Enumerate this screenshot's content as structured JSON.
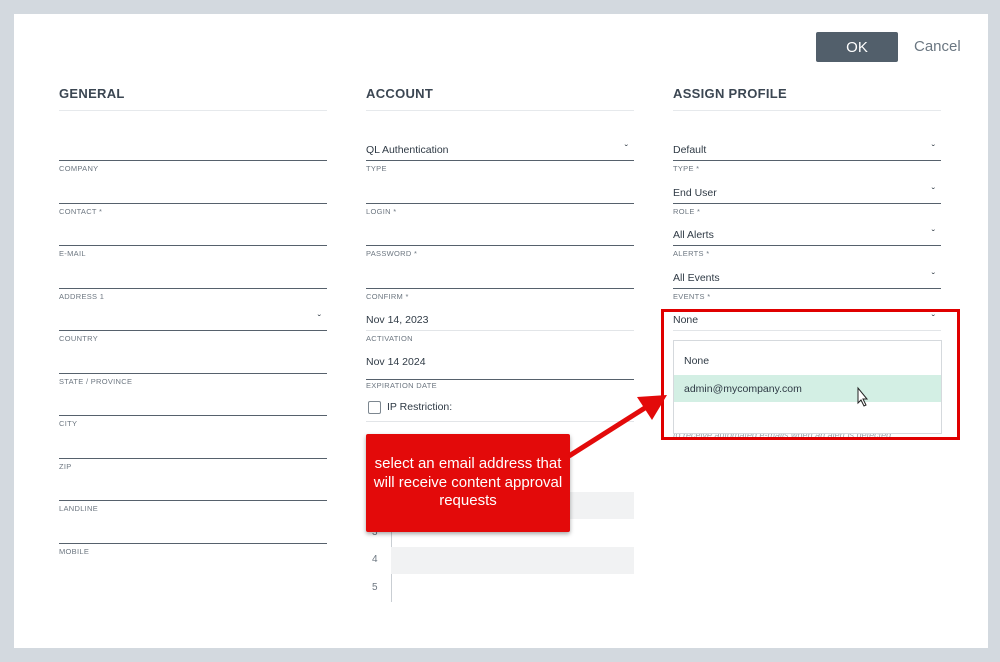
{
  "buttons": {
    "ok": "OK",
    "cancel": "Cancel"
  },
  "general": {
    "title": "GENERAL",
    "fields": [
      {
        "label": "COMPANY",
        "value": ""
      },
      {
        "label": "CONTACT *",
        "value": ""
      },
      {
        "label": "E-MAIL",
        "value": ""
      },
      {
        "label": "ADDRESS 1",
        "value": ""
      },
      {
        "label": "COUNTRY",
        "value": ""
      },
      {
        "label": "STATE / PROVINCE",
        "value": ""
      },
      {
        "label": "CITY",
        "value": ""
      },
      {
        "label": "ZIP",
        "value": ""
      },
      {
        "label": "LANDLINE",
        "value": ""
      },
      {
        "label": "MOBILE",
        "value": ""
      }
    ]
  },
  "account": {
    "title": "ACCOUNT",
    "type_value": "QL Authentication",
    "type_label": "TYPE",
    "login_label": "LOGIN *",
    "password_label": "PASSWORD *",
    "confirm_label": "CONFIRM *",
    "activation_value": "Nov 14, 2023",
    "activation_label": "ACTIVATION",
    "expiration_value": "Nov 14 2024",
    "expiration_label": "EXPIRATION DATE",
    "ip_restriction": "IP Restriction:",
    "row_numbers": [
      "3",
      "4",
      "5"
    ]
  },
  "profile": {
    "title": "ASSIGN PROFILE",
    "type_value": "Default",
    "type_label": "TYPE *",
    "role_value": "End User",
    "role_label": "ROLE *",
    "alerts_value": "All Alerts",
    "alerts_label": "ALERTS *",
    "events_value": "All Events",
    "events_label": "EVENTS *",
    "email_select_value": "None",
    "dropdown_options": [
      "None",
      "admin@mycompany.com"
    ],
    "hint": "to receive automated e-mails when an alert is detected."
  },
  "callout": {
    "text": "select an email address that will receive content approval requests"
  },
  "colors": {
    "accent_red": "#e30a0a",
    "selected_option": "#d3efe4",
    "ok_button": "#525f6b"
  },
  "icons": [
    "chevron-down-icon",
    "mouse-cursor-icon",
    "arrow-icon",
    "checkbox-icon"
  ]
}
